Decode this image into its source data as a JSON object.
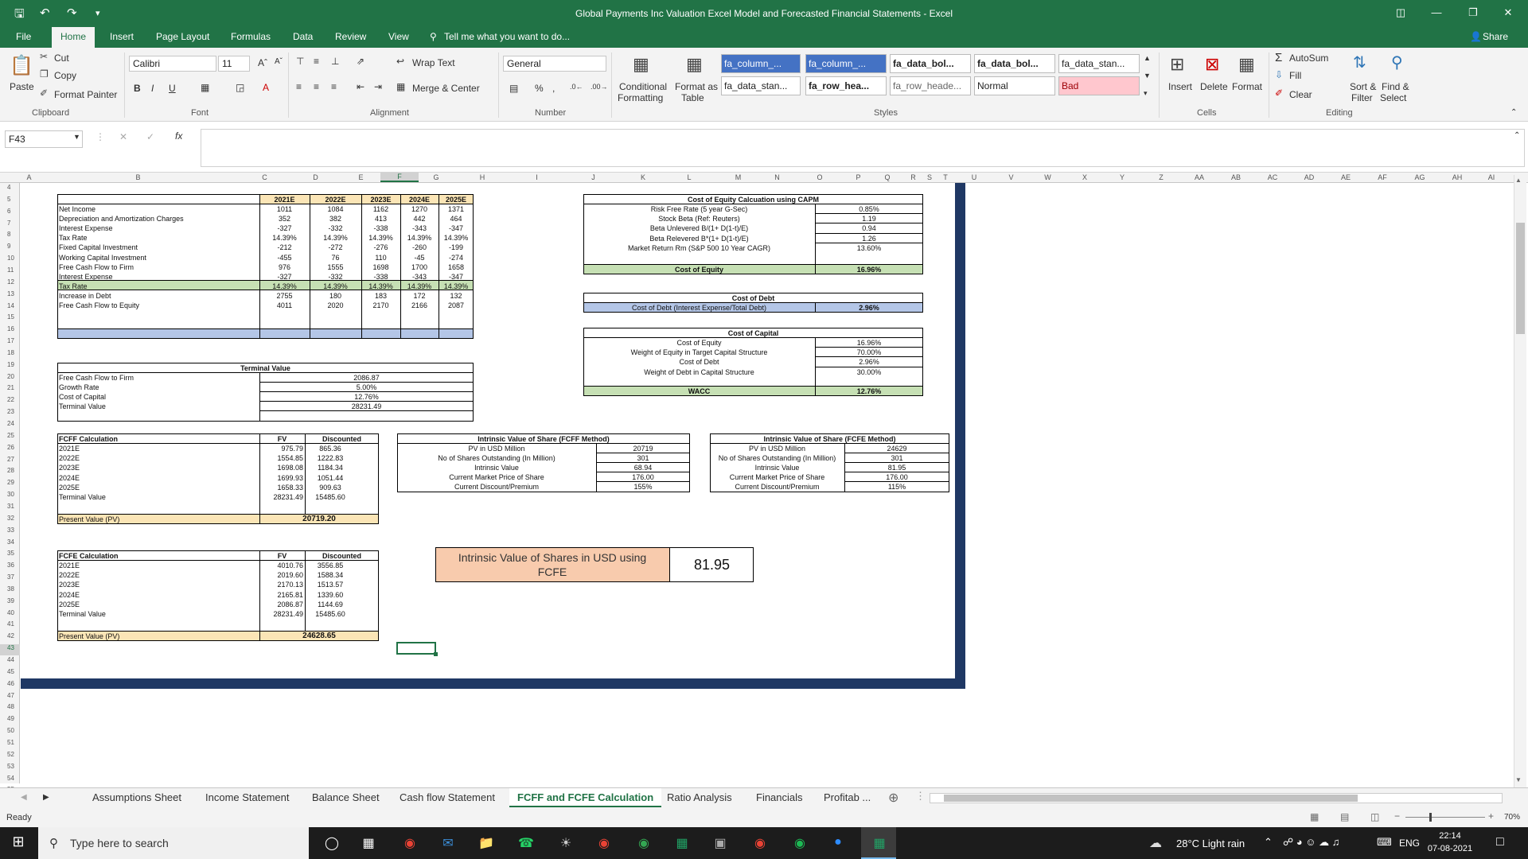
{
  "window": {
    "title": "Global Payments Inc Valuation Excel Model and Forecasted Financial Statements - Excel",
    "share": "Share"
  },
  "ribbon_tabs": [
    "File",
    "Home",
    "Insert",
    "Page Layout",
    "Formulas",
    "Data",
    "Review",
    "View"
  ],
  "tell_me": "Tell me what you want to do...",
  "clipboard": {
    "paste": "Paste",
    "cut": "Cut",
    "copy": "Copy",
    "format_painter": "Format Painter",
    "group": "Clipboard"
  },
  "font": {
    "name": "Calibri",
    "size": "11",
    "group": "Font"
  },
  "alignment": {
    "wrap": "Wrap Text",
    "merge": "Merge & Center",
    "group": "Alignment"
  },
  "number": {
    "format": "General",
    "group": "Number"
  },
  "styles": {
    "cond": "Conditional",
    "cond2": "Formatting",
    "fmt": "Format as",
    "fmt2": "Table",
    "items": [
      "fa_column_...",
      "fa_column_...",
      "fa_data_bol...",
      "fa_data_bol...",
      "fa_data_stan...",
      "fa_data_stan...",
      "fa_row_hea...",
      "fa_row_heade...",
      "Normal",
      "Bad"
    ],
    "group": "Styles"
  },
  "cells": {
    "insert": "Insert",
    "delete": "Delete",
    "format": "Format",
    "group": "Cells"
  },
  "editing": {
    "autosum": "AutoSum",
    "fill": "Fill",
    "clear": "Clear",
    "sort": "Sort &",
    "sort2": "Filter",
    "find": "Find &",
    "find2": "Select",
    "group": "Editing"
  },
  "namebox": "F43",
  "columns": [
    "A",
    "B",
    "C",
    "D",
    "E",
    "F",
    "G",
    "H",
    "I",
    "J",
    "K",
    "L",
    "M",
    "N",
    "O",
    "P",
    "Q",
    "R",
    "S",
    "T",
    "U",
    "V",
    "W",
    "X",
    "Y",
    "Z",
    "AA",
    "AB",
    "AC",
    "AD",
    "AE",
    "AF",
    "AG",
    "AH",
    "AI"
  ],
  "rows": [
    "4",
    "5",
    "6",
    "7",
    "8",
    "9",
    "10",
    "11",
    "12",
    "13",
    "14",
    "15",
    "16",
    "17",
    "18",
    "19",
    "20",
    "21",
    "22",
    "23",
    "24",
    "25",
    "26",
    "27",
    "28",
    "29",
    "30",
    "31",
    "32",
    "33",
    "34",
    "35",
    "36",
    "37",
    "38",
    "39",
    "40",
    "41",
    "42",
    "43",
    "44",
    "45",
    "46",
    "47",
    "48",
    "49",
    "50",
    "51",
    "52",
    "53",
    "54",
    "55"
  ],
  "fcf": {
    "headers": [
      "2021E",
      "2022E",
      "2023E",
      "2024E",
      "2025E"
    ],
    "rows": [
      {
        "label": "Net Income",
        "v": [
          "1011",
          "1084",
          "1162",
          "1270",
          "1371"
        ]
      },
      {
        "label": "Depreciation and Amortization Charges",
        "v": [
          "352",
          "382",
          "413",
          "442",
          "464"
        ]
      },
      {
        "label": "Interest Expense",
        "v": [
          "-327",
          "-332",
          "-338",
          "-343",
          "-347"
        ]
      },
      {
        "label": "Tax Rate",
        "v": [
          "14.39%",
          "14.39%",
          "14.39%",
          "14.39%",
          "14.39%"
        ]
      },
      {
        "label": "Fixed Capital Investment",
        "v": [
          "-212",
          "-272",
          "-276",
          "-260",
          "-199"
        ]
      },
      {
        "label": "Working Capital Investment",
        "v": [
          "-455",
          "76",
          "110",
          "-45",
          "-274"
        ]
      },
      {
        "label": "Free Cash Flow to Firm",
        "v": [
          "976",
          "1555",
          "1698",
          "1700",
          "1658"
        ]
      },
      {
        "label": "Interest Expense",
        "v": [
          "-327",
          "-332",
          "-338",
          "-343",
          "-347"
        ]
      },
      {
        "label": "Tax Rate",
        "v": [
          "14.39%",
          "14.39%",
          "14.39%",
          "14.39%",
          "14.39%"
        ]
      },
      {
        "label": "Increase in Debt",
        "v": [
          "2755",
          "180",
          "183",
          "172",
          "132"
        ]
      },
      {
        "label": "Free Cash Flow to Equity",
        "v": [
          "4011",
          "2020",
          "2170",
          "2166",
          "2087"
        ]
      }
    ]
  },
  "terminal": {
    "title": "Terminal Value",
    "rows": [
      [
        "Free Cash Flow to Firm",
        "2086.87"
      ],
      [
        "Growth Rate",
        "5.00%"
      ],
      [
        "Cost of Capital",
        "12.76%"
      ],
      [
        "Terminal Value",
        "28231.49"
      ]
    ]
  },
  "fcff": {
    "title": "FCFF Calculation",
    "fv": "FV",
    "disc": "Discounted",
    "rows": [
      [
        "2021E",
        "975.79",
        "865.36"
      ],
      [
        "2022E",
        "1554.85",
        "1222.83"
      ],
      [
        "2023E",
        "1698.08",
        "1184.34"
      ],
      [
        "2024E",
        "1699.93",
        "1051.44"
      ],
      [
        "2025E",
        "1658.33",
        "909.63"
      ],
      [
        "Terminal Value",
        "28231.49",
        "15485.60"
      ]
    ],
    "pv_label": "Present Value (PV)",
    "pv": "20719.20"
  },
  "fcfe": {
    "title": "FCFE Calculation",
    "fv": "FV",
    "disc": "Discounted",
    "rows": [
      [
        "2021E",
        "4010.76",
        "3556.85"
      ],
      [
        "2022E",
        "2019.60",
        "1588.34"
      ],
      [
        "2023E",
        "2170.13",
        "1513.57"
      ],
      [
        "2024E",
        "2165.81",
        "1339.60"
      ],
      [
        "2025E",
        "2086.87",
        "1144.69"
      ],
      [
        "Terminal Value",
        "28231.49",
        "15485.60"
      ]
    ],
    "pv_label": "Present Value (PV)",
    "pv": "24628.65"
  },
  "capm": {
    "title": "Cost of Equity Calcuation using CAPM",
    "rows": [
      [
        "Risk Free Rate (5 year G-Sec)",
        "0.85%"
      ],
      [
        "Stock Beta (Ref: Reuters)",
        "1.19"
      ],
      [
        "Beta Unlevered B/(1+ D(1-t)/E)",
        "0.94"
      ],
      [
        "Beta Relevered B*(1+ D(1-t)/E)",
        "1.26"
      ],
      [
        "Market Return Rm (S&P 500 10 Year CAGR)",
        "13.60%"
      ]
    ],
    "total_label": "Cost of Equity",
    "total": "16.96%"
  },
  "debt": {
    "title": "Cost of Debt",
    "label": "Cost of Debt (Interest Expense/Total Debt)",
    "value": "2.96%"
  },
  "capital": {
    "title": "Cost of Capital",
    "rows": [
      [
        "Cost of Equity",
        "16.96%"
      ],
      [
        "Weight of Equity in Target Capital Structure",
        "70.00%"
      ],
      [
        "Cost of Debt",
        "2.96%"
      ],
      [
        "Weight of Debt in Capital Structure",
        "30.00%"
      ]
    ],
    "total_label": "WACC",
    "total": "12.76%"
  },
  "iv_fcff": {
    "title": "Intrinsic Value of Share (FCFF Method)",
    "rows": [
      [
        "PV in USD Million",
        "20719"
      ],
      [
        "No of Shares Outstanding (In Million)",
        "301"
      ],
      [
        "Intrinsic Value",
        "68.94"
      ],
      [
        "Current Market Price of Share",
        "176.00"
      ],
      [
        "Current Discount/Premium",
        "155%"
      ]
    ]
  },
  "iv_fcfe": {
    "title": "Intrinsic Value of Share (FCFE Method)",
    "rows": [
      [
        "PV in USD Million",
        "24629"
      ],
      [
        "No of Shares Outstanding (In Million)",
        "301"
      ],
      [
        "Intrinsic Value",
        "81.95"
      ],
      [
        "Current Market Price of Share",
        "176.00"
      ],
      [
        "Current Discount/Premium",
        "115%"
      ]
    ]
  },
  "summary": {
    "label": "Intrinsic Value of Shares in USD using FCFE",
    "value": "81.95"
  },
  "sheets": [
    "Assumptions Sheet",
    "Income Statement",
    "Balance Sheet",
    "Cash flow Statement",
    "FCFF and FCFE Calculation",
    "Ratio Analysis",
    "Financials",
    "Profitab ..."
  ],
  "status": {
    "ready": "Ready",
    "zoom": "70%"
  },
  "taskbar": {
    "search": "Type here to search",
    "weather": "28°C  Light rain",
    "lang": "ENG",
    "time": "22:14",
    "date": "07-08-2021"
  },
  "colors": {
    "excel_green": "#217346",
    "navy": "#1f3864",
    "yellow": "#fbe5b6",
    "green": "#c6e0b4",
    "blue": "#b4c6e7",
    "orange": "#f8cbad",
    "bad": "#ffc7ce"
  }
}
